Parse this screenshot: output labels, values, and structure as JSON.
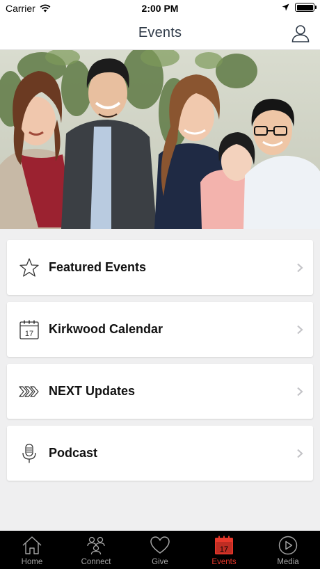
{
  "status_bar": {
    "carrier": "Carrier",
    "time": "2:00 PM"
  },
  "nav": {
    "title": "Events"
  },
  "menu": {
    "items": [
      {
        "label": "Featured Events",
        "icon": "star-icon"
      },
      {
        "label": "Kirkwood Calendar",
        "icon": "calendar-icon",
        "icon_text": "17"
      },
      {
        "label": "NEXT Updates",
        "icon": "chevrons-icon"
      },
      {
        "label": "Podcast",
        "icon": "microphone-icon"
      }
    ]
  },
  "tabbar": {
    "tabs": [
      {
        "label": "Home",
        "icon": "home-icon"
      },
      {
        "label": "Connect",
        "icon": "people-icon"
      },
      {
        "label": "Give",
        "icon": "heart-icon"
      },
      {
        "label": "Events",
        "icon": "calendar-icon",
        "icon_text": "17",
        "active": true
      },
      {
        "label": "Media",
        "icon": "play-icon"
      }
    ]
  },
  "colors": {
    "accent": "#e8382b",
    "tabbar_bg": "#000000",
    "tab_inactive": "#a6a6a6",
    "nav_title": "#2f3a48",
    "page_bg": "#efeff0"
  }
}
